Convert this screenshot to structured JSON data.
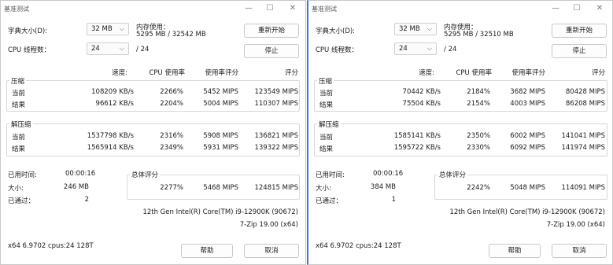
{
  "windows": [
    {
      "title": "基准测试",
      "dict_label": "字典大小(D):",
      "dict_value": "32 MB",
      "mem_label": "内存使用：",
      "mem_value": "5295 MB / 32542 MB",
      "restart": "重新开始",
      "threads_label": "CPU 线程数：",
      "threads_value": "24",
      "threads_total": "/ 24",
      "stop": "停止",
      "headers": {
        "speed": "速度:",
        "cpu": "CPU 使用率",
        "rating": "使用率评分",
        "score": "评分"
      },
      "compress": {
        "title": "压缩",
        "rows": [
          {
            "label": "当前",
            "speed": "108209 KB/s",
            "cpu": "2266%",
            "rating": "5452 MIPS",
            "score": "123549 MIPS"
          },
          {
            "label": "结果",
            "speed": "96612 KB/s",
            "cpu": "2204%",
            "rating": "5004 MIPS",
            "score": "110307 MIPS"
          }
        ]
      },
      "decompress": {
        "title": "解压缩",
        "rows": [
          {
            "label": "当前",
            "speed": "1537798 KB/s",
            "cpu": "2316%",
            "rating": "5908 MIPS",
            "score": "136821 MIPS"
          },
          {
            "label": "结果",
            "speed": "1565914 KB/s",
            "cpu": "2349%",
            "rating": "5931 MIPS",
            "score": "139322 MIPS"
          }
        ]
      },
      "elapsed_label": "已用时间:",
      "elapsed_value": "00:00:16",
      "size_label": "大小:",
      "size_value": "246 MB",
      "passes_label": "已通过：",
      "passes_value": "2",
      "total": {
        "title": "总体评分",
        "cpu": "2277%",
        "rating": "5468 MIPS",
        "score": "124815 MIPS"
      },
      "cpu_name": "12th Gen Intel(R) Core(TM) i9-12900K (90672)",
      "version": "7-Zip 19.00 (x64)",
      "sysinfo": "x64 6.9702 cpus:24 128T",
      "help": "帮助",
      "cancel": "取消"
    },
    {
      "title": "基准测试",
      "dict_label": "字典大小(D):",
      "dict_value": "32 MB",
      "mem_label": "内存使用：",
      "mem_value": "5295 MB / 32510 MB",
      "restart": "重新开始",
      "threads_label": "CPU 线程数：",
      "threads_value": "24",
      "threads_total": "/ 24",
      "stop": "停止",
      "headers": {
        "speed": "速度:",
        "cpu": "CPU 使用率",
        "rating": "使用率评分",
        "score": "评分"
      },
      "compress": {
        "title": "压缩",
        "rows": [
          {
            "label": "当前",
            "speed": "70442 KB/s",
            "cpu": "2184%",
            "rating": "3682 MIPS",
            "score": "80428 MIPS"
          },
          {
            "label": "结果",
            "speed": "75504 KB/s",
            "cpu": "2154%",
            "rating": "4003 MIPS",
            "score": "86208 MIPS"
          }
        ]
      },
      "decompress": {
        "title": "解压缩",
        "rows": [
          {
            "label": "当前",
            "speed": "1585141 KB/s",
            "cpu": "2350%",
            "rating": "6002 MIPS",
            "score": "141041 MIPS"
          },
          {
            "label": "结果",
            "speed": "1595722 KB/s",
            "cpu": "2330%",
            "rating": "6092 MIPS",
            "score": "141974 MIPS"
          }
        ]
      },
      "elapsed_label": "已用时间:",
      "elapsed_value": "00:00:16",
      "size_label": "大小:",
      "size_value": "384 MB",
      "passes_label": "已通过：",
      "passes_value": "1",
      "total": {
        "title": "总体评分",
        "cpu": "2242%",
        "rating": "5048 MIPS",
        "score": "114091 MIPS"
      },
      "cpu_name": "12th Gen Intel(R) Core(TM) i9-12900K (90672)",
      "version": "7-Zip 19.00 (x64)",
      "sysinfo": "x64 6.9702 cpus:24 128T",
      "help": "帮助",
      "cancel": "取消"
    }
  ],
  "controls": {
    "minimize": "—",
    "maximize": "☐",
    "close": "✕",
    "chevron": "⌵"
  }
}
